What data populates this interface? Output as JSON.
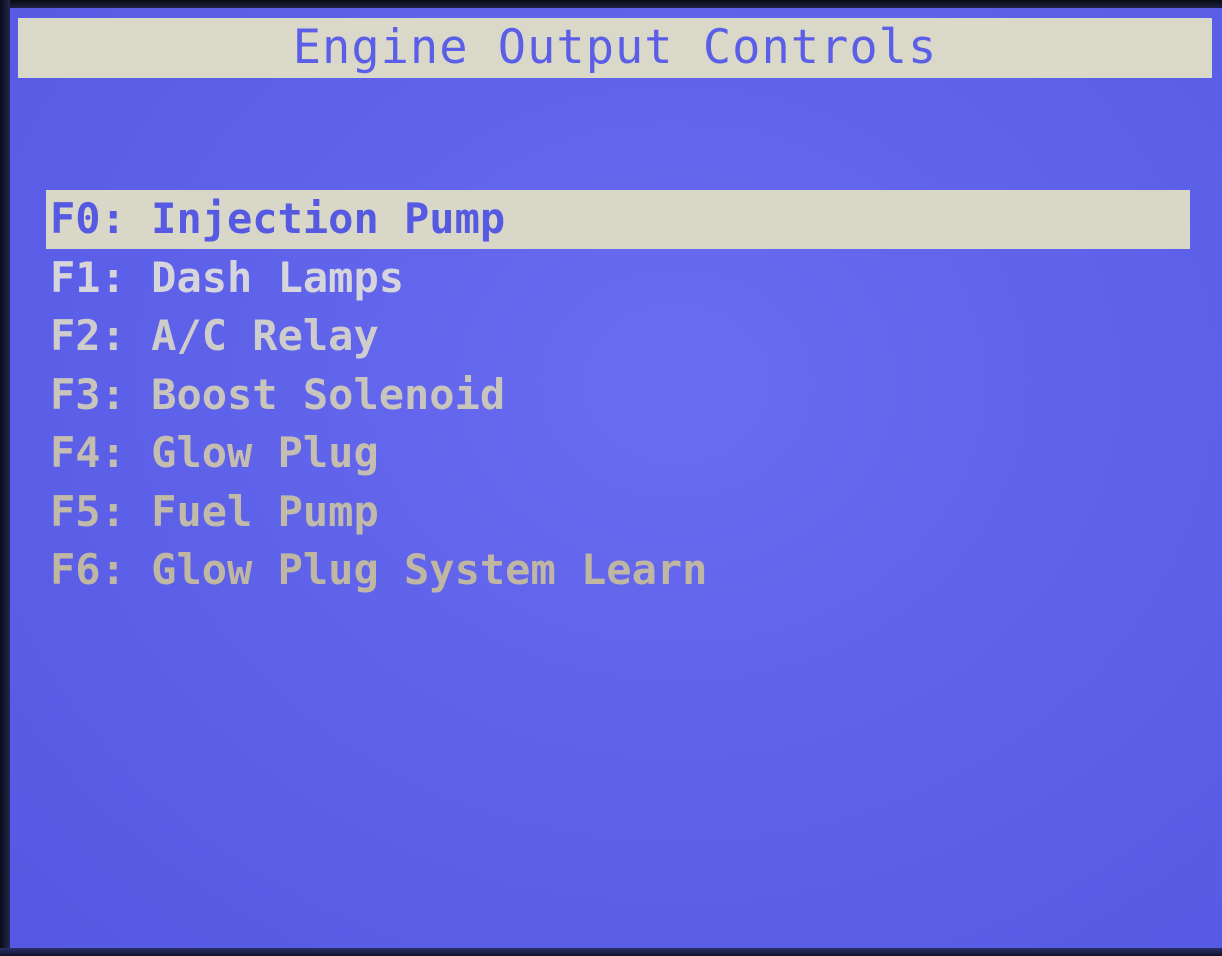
{
  "screen": {
    "title": "Engine Output Controls",
    "menu_items": [
      {
        "key": "F0:",
        "label": "Injection Pump",
        "selected": true
      },
      {
        "key": "F1:",
        "label": "Dash Lamps",
        "selected": false
      },
      {
        "key": "F2:",
        "label": "A/C Relay",
        "selected": false
      },
      {
        "key": "F3:",
        "label": "Boost Solenoid",
        "selected": false
      },
      {
        "key": "F4:",
        "label": "Glow Plug",
        "selected": false
      },
      {
        "key": "F5:",
        "label": "Fuel Pump",
        "selected": false
      },
      {
        "key": "F6:",
        "label": "Glow Plug System Learn",
        "selected": false
      }
    ]
  },
  "colors": {
    "background": "#5f63ea",
    "title_bar": "#d9d8c9",
    "title_text": "#5b5ee6",
    "selection_bar": "#d8d7c8",
    "menu_text": "#c9c4bc"
  }
}
